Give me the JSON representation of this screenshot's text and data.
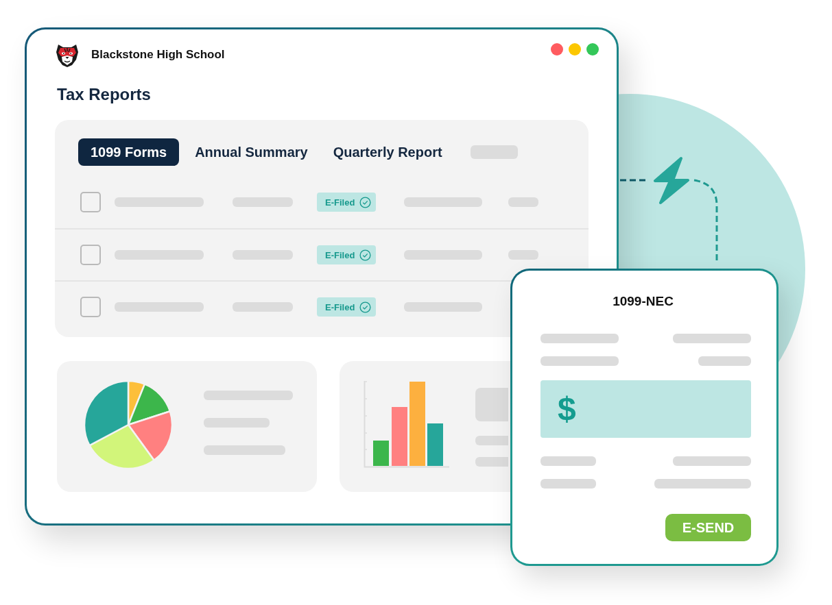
{
  "window": {
    "title": "Blackstone High School",
    "controls": [
      {
        "color": "#ff5b5f"
      },
      {
        "color": "#fcc700"
      },
      {
        "color": "#34c759"
      }
    ]
  },
  "heading": "Tax Reports",
  "tabs": [
    {
      "label": "1099 Forms",
      "selected": true
    },
    {
      "label": "Annual Summary",
      "selected": false
    },
    {
      "label": "Quarterly Report",
      "selected": false
    }
  ],
  "table": {
    "rows": [
      {
        "checked": false,
        "status": "E-Filed"
      },
      {
        "checked": false,
        "status": "E-Filed"
      },
      {
        "checked": false,
        "status": "E-Filed"
      }
    ]
  },
  "form_card": {
    "title": "1099-NEC",
    "currency_symbol": "$",
    "button": "E-SEND"
  }
}
